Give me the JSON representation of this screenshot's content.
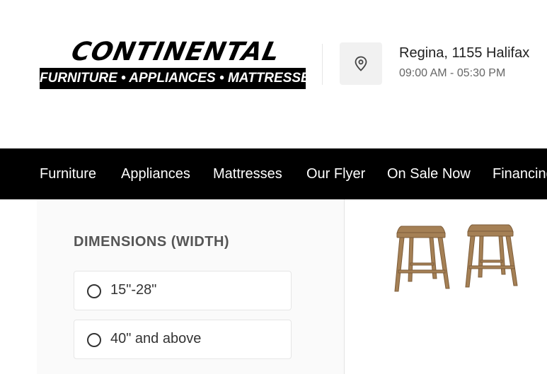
{
  "header": {
    "logo": {
      "wordmark": "CONTINENTAL",
      "tagline": "FURNITURE • APPLIANCES • MATTRESSES"
    },
    "location": {
      "icon": "map-pin-icon",
      "title": "Regina, 1155 Halifax",
      "hours": "09:00 AM - 05:30 PM"
    }
  },
  "nav": {
    "items": [
      "Furniture",
      "Appliances",
      "Mattresses",
      "Our Flyer",
      "On Sale Now",
      "Financing"
    ]
  },
  "filters": {
    "heading": "DIMENSIONS (WIDTH)",
    "options": [
      {
        "label": "15\"-28\"",
        "selected": false
      },
      {
        "label": "40\" and above",
        "selected": false
      }
    ]
  },
  "colors": {
    "nav_background": "#000000",
    "nav_text": "#ffffff",
    "panel_background": "#fafafa",
    "product_wood": "#a58055"
  }
}
